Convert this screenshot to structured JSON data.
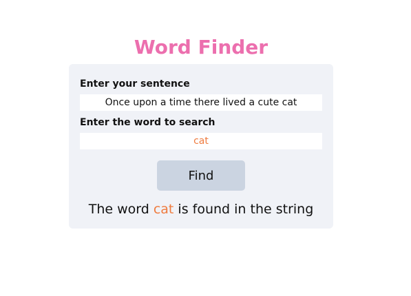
{
  "app": {
    "title": "Word Finder"
  },
  "form": {
    "sentence_label": "Enter your sentence",
    "sentence_value": "Once upon a time there lived a cute cat",
    "word_label": "Enter the word to search",
    "word_value": "cat",
    "find_label": "Find"
  },
  "result": {
    "prefix": "The word ",
    "word": "cat",
    "suffix": " is found in the string"
  },
  "colors": {
    "title": "#ec6fae",
    "highlight": "#ef7b3e",
    "card_background": "#f0f2f7",
    "button_background": "#cbd4e1"
  }
}
